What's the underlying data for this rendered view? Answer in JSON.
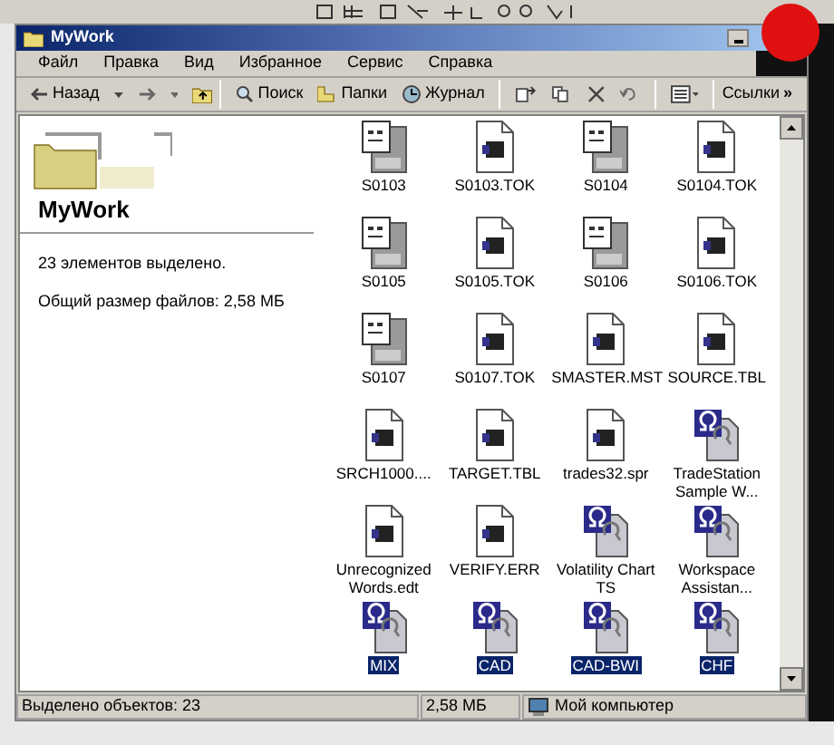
{
  "window": {
    "title": "MyWork"
  },
  "menu": [
    "Файл",
    "Правка",
    "Вид",
    "Избранное",
    "Сервис",
    "Справка"
  ],
  "toolbar": {
    "back": "Назад",
    "search": "Поиск",
    "folders": "Папки",
    "history": "Журнал",
    "links": "Ссылки",
    "links_more": "»"
  },
  "side_panel": {
    "title": "MyWork",
    "selection_text": "23 элементов выделено.",
    "size_text": "Общий размер файлов: 2,58 МБ"
  },
  "files": [
    {
      "name": "S0103",
      "kind": "doc",
      "selected": false
    },
    {
      "name": "S0103.TOK",
      "kind": "tok",
      "selected": false
    },
    {
      "name": "S0104",
      "kind": "doc",
      "selected": false
    },
    {
      "name": "S0104.TOK",
      "kind": "tok",
      "selected": false
    },
    {
      "name": "S0105",
      "kind": "doc",
      "selected": false
    },
    {
      "name": "S0105.TOK",
      "kind": "tok",
      "selected": false
    },
    {
      "name": "S0106",
      "kind": "doc",
      "selected": false
    },
    {
      "name": "S0106.TOK",
      "kind": "tok",
      "selected": false
    },
    {
      "name": "S0107",
      "kind": "doc",
      "selected": false
    },
    {
      "name": "S0107.TOK",
      "kind": "tok",
      "selected": false
    },
    {
      "name": "SMASTER.MST",
      "kind": "tok",
      "selected": false
    },
    {
      "name": "SOURCE.TBL",
      "kind": "tok",
      "selected": false
    },
    {
      "name": "SRCH1000....",
      "kind": "tok",
      "selected": false
    },
    {
      "name": "TARGET.TBL",
      "kind": "tok",
      "selected": false
    },
    {
      "name": "trades32.spr",
      "kind": "tok",
      "selected": false
    },
    {
      "name": "TradeStation Sample W...",
      "kind": "ts",
      "selected": false
    },
    {
      "name": "Unrecognized Words.edt",
      "kind": "tok",
      "selected": false
    },
    {
      "name": "VERIFY.ERR",
      "kind": "tok",
      "selected": false
    },
    {
      "name": "Volatility Chart TS",
      "kind": "ts",
      "selected": false
    },
    {
      "name": "Workspace Assistan...",
      "kind": "ts",
      "selected": false
    },
    {
      "name": "MIX",
      "kind": "ts",
      "selected": true
    },
    {
      "name": "CAD",
      "kind": "ts",
      "selected": true
    },
    {
      "name": "CAD-BWI",
      "kind": "ts",
      "selected": true
    },
    {
      "name": "CHF",
      "kind": "ts",
      "selected": true
    }
  ],
  "status_bar": {
    "selection": "Выделено объектов: 23",
    "size": "2,58 МБ",
    "zone": "Мой компьютер"
  }
}
